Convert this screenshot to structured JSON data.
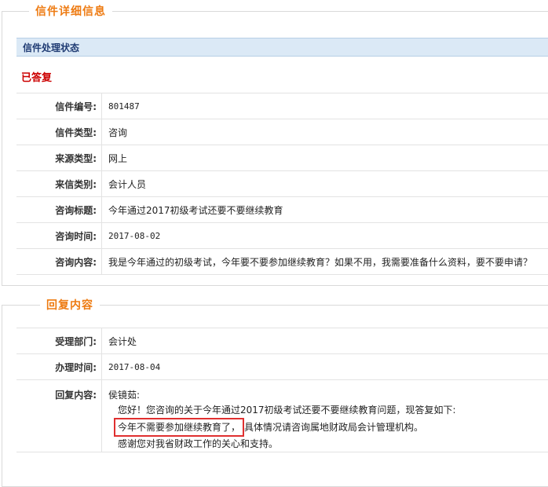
{
  "letter_panel": {
    "title": "信件详细信息",
    "status_header": "信件处理状态",
    "status": "已答复",
    "fields": [
      {
        "label": "信件编号:",
        "value": "801487"
      },
      {
        "label": "信件类型:",
        "value": "咨询"
      },
      {
        "label": "来源类型:",
        "value": "网上"
      },
      {
        "label": "来信类别:",
        "value": "会计人员"
      },
      {
        "label": "咨询标题:",
        "value": "今年通过2017初级考试还要不要继续教育"
      },
      {
        "label": "咨询时间:",
        "value": "2017-08-02"
      },
      {
        "label": "咨询内容:",
        "value": "我是今年通过的初级考试，今年要不要参加继续教育？如果不用，我需要准备什么资料，要不要申请？"
      }
    ]
  },
  "reply_panel": {
    "title": "回复内容",
    "fields": [
      {
        "label": "受理部门:",
        "value": "会计处"
      },
      {
        "label": "办理时间:",
        "value": "2017-08-04"
      }
    ],
    "reply_label": "回复内容:",
    "reply": {
      "greeting": "侯镜茹:",
      "line1": "您好！您咨询的关于今年通过2017初级考试还要不要继续教育问题，现答复如下:",
      "line2_highlight": "今年不需要参加继续教育了，",
      "line2_rest": "具体情况请咨询属地财政局会计管理机构。",
      "line3": "感谢您对我省财政工作的关心和支持。"
    }
  },
  "colors": {
    "accent": "#ee7b12",
    "status": "#cc0000",
    "header_bg": "#dbe9f6",
    "highlight_border": "#e03030"
  }
}
